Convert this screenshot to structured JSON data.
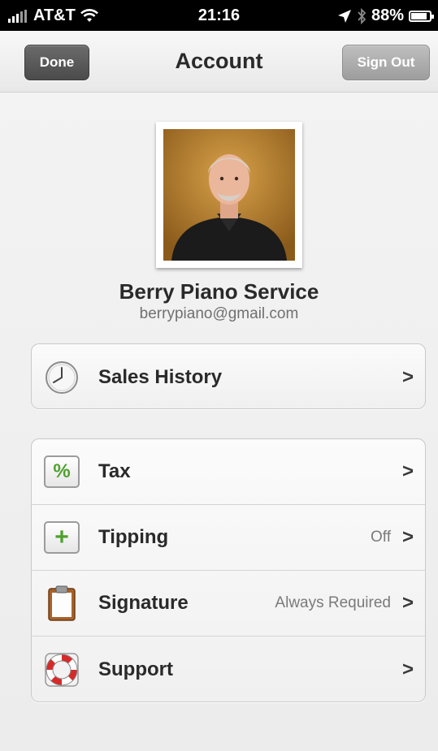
{
  "status_bar": {
    "carrier": "AT&T",
    "time": "21:16",
    "battery": "88%",
    "battery_level": 0.88,
    "icons": [
      "signal-icon",
      "wifi-icon",
      "location-arrow-icon",
      "bluetooth-icon",
      "battery-icon"
    ]
  },
  "nav": {
    "title": "Account",
    "done_label": "Done",
    "sign_out_label": "Sign Out",
    "done_color": "#555555",
    "sign_out_color": "#a8a8a8"
  },
  "profile": {
    "name": "Berry Piano Service",
    "email": "berrypiano@gmail.com"
  },
  "sections": [
    {
      "rows": [
        {
          "icon": "clock-icon",
          "label": "Sales History",
          "value": ""
        }
      ]
    },
    {
      "rows": [
        {
          "icon": "percent-icon",
          "label": "Tax",
          "value": ""
        },
        {
          "icon": "plus-icon",
          "label": "Tipping",
          "value": "Off"
        },
        {
          "icon": "clipboard-icon",
          "label": "Signature",
          "value": "Always Required"
        },
        {
          "icon": "lifebuoy-icon",
          "label": "Support",
          "value": ""
        }
      ]
    }
  ],
  "chevron": ">",
  "accent_green": "#4ea12e"
}
